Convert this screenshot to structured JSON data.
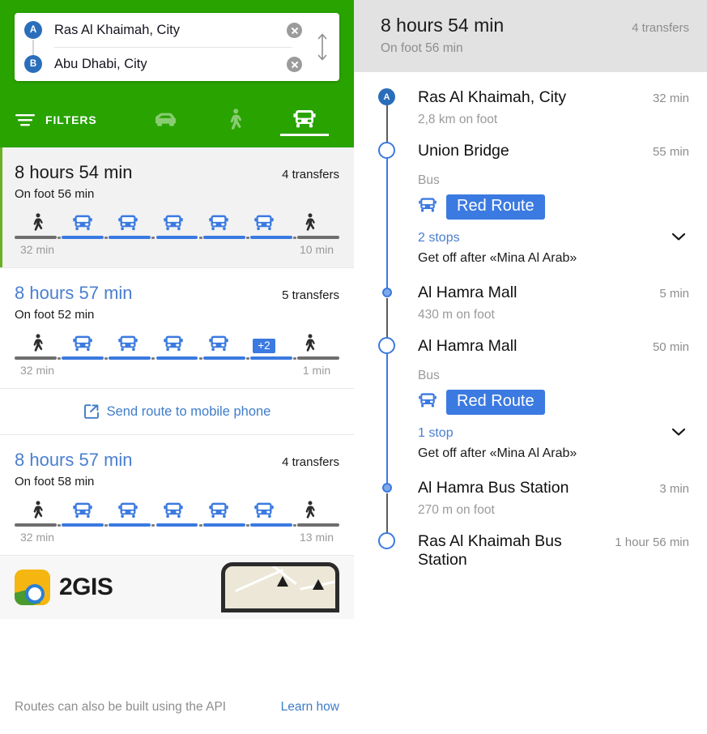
{
  "search": {
    "origin": {
      "marker": "A",
      "value": "Ras Al Khaimah, City"
    },
    "destination": {
      "marker": "B",
      "value": "Abu Dhabi, City"
    },
    "swap_icon": "swap-vertical-icon",
    "clear_icon": "close-circle-icon"
  },
  "toolbar": {
    "filters_label": "FILTERS",
    "filters_icon": "filter-icon",
    "modes": [
      {
        "name": "car",
        "icon": "car-icon",
        "active": false
      },
      {
        "name": "pedestrian",
        "icon": "pedestrian-icon",
        "active": false
      },
      {
        "name": "public-transport",
        "icon": "bus-icon",
        "active": true
      }
    ]
  },
  "routes": [
    {
      "duration": "8 hours 54 min",
      "transfers": "4 transfers",
      "on_foot": "On foot 56 min",
      "start_time": "32 min",
      "end_time": "10 min",
      "selected": true,
      "segments": [
        {
          "type": "walk",
          "icon": "pedestrian-icon"
        },
        {
          "type": "bus",
          "icon": "bus-icon"
        },
        {
          "type": "bus",
          "icon": "bus-icon"
        },
        {
          "type": "bus",
          "icon": "bus-icon"
        },
        {
          "type": "bus",
          "icon": "bus-icon"
        },
        {
          "type": "bus",
          "icon": "bus-icon"
        },
        {
          "type": "walk",
          "icon": "pedestrian-icon"
        }
      ]
    },
    {
      "duration": "8 hours 57 min",
      "transfers": "5 transfers",
      "on_foot": "On foot 52 min",
      "start_time": "32 min",
      "end_time": "1 min",
      "selected": false,
      "segments": [
        {
          "type": "walk",
          "icon": "pedestrian-icon"
        },
        {
          "type": "bus",
          "icon": "bus-icon"
        },
        {
          "type": "bus",
          "icon": "bus-icon"
        },
        {
          "type": "bus",
          "icon": "bus-icon"
        },
        {
          "type": "bus",
          "icon": "bus-icon"
        },
        {
          "type": "more",
          "badge": "+2"
        },
        {
          "type": "walk",
          "icon": "pedestrian-icon"
        }
      ]
    },
    {
      "duration": "8 hours 57 min",
      "transfers": "4 transfers",
      "on_foot": "On foot 58 min",
      "start_time": "32 min",
      "end_time": "13 min",
      "selected": false,
      "segments": [
        {
          "type": "walk",
          "icon": "pedestrian-icon"
        },
        {
          "type": "bus",
          "icon": "bus-icon"
        },
        {
          "type": "bus",
          "icon": "bus-icon"
        },
        {
          "type": "bus",
          "icon": "bus-icon"
        },
        {
          "type": "bus",
          "icon": "bus-icon"
        },
        {
          "type": "bus",
          "icon": "bus-icon"
        },
        {
          "type": "walk",
          "icon": "pedestrian-icon"
        }
      ]
    }
  ],
  "send_route": {
    "label": "Send route to mobile phone",
    "icon": "send-to-phone-icon"
  },
  "promo": {
    "app_name": "2GIS",
    "logo_icon": "2gis-logo-icon",
    "phone_icon": "phone-mockup-icon"
  },
  "footer": {
    "text": "Routes can also be built using the API",
    "link": "Learn how"
  },
  "details": {
    "header": {
      "duration": "8 hours 54 min",
      "transfers": "4 transfers",
      "on_foot": "On foot 56 min"
    },
    "steps": [
      {
        "kind": "origin",
        "marker": "A",
        "name": "Ras Al Khaimah, City",
        "time": "32 min",
        "sub": "2,8 km on foot"
      },
      {
        "kind": "board",
        "name": "Union Bridge",
        "time": "55 min",
        "mode": "Bus",
        "route_icon": "bus-icon",
        "route_name": "Red Route",
        "stops": "2 stops",
        "chevron": "chevron-down-icon",
        "get_off": "Get off after «Mina Al Arab»"
      },
      {
        "kind": "transfer",
        "name": "Al Hamra Mall",
        "time": "5 min",
        "sub": "430 m on foot"
      },
      {
        "kind": "board",
        "name": "Al Hamra Mall",
        "time": "50 min",
        "mode": "Bus",
        "route_icon": "bus-icon",
        "route_name": "Red Route",
        "stops": "1 stop",
        "chevron": "chevron-down-icon",
        "get_off": "Get off after «Mina Al Arab»"
      },
      {
        "kind": "transfer",
        "name": "Al Hamra Bus Station",
        "time": "3 min",
        "sub": "270 m on foot"
      },
      {
        "kind": "board",
        "name": "Ras Al Khaimah Bus Station",
        "time": "1 hour 56 min"
      }
    ]
  },
  "colors": {
    "brand_green": "#29a300",
    "accent_blue": "#3b7ae0",
    "marker_blue": "#2a6ebb",
    "muted_gray": "#8d8d8d",
    "panel_gray": "#e2e2e2"
  }
}
